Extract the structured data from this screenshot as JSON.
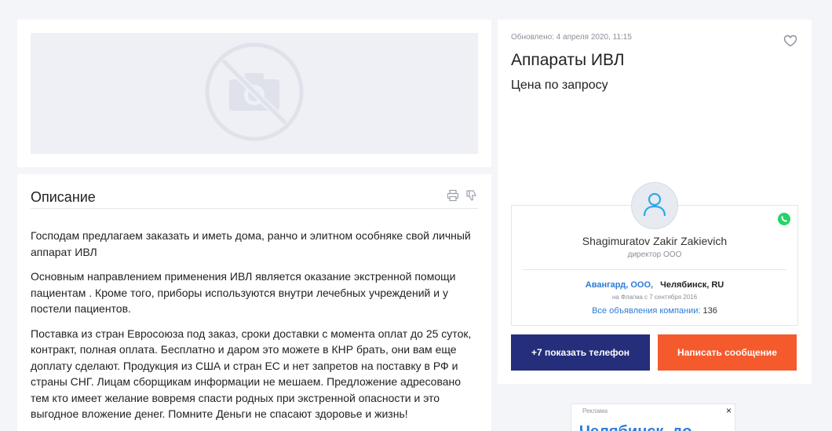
{
  "listing": {
    "updated": "Обновлено: 4 апреля 2020, 11:15",
    "title": "Аппараты ИВЛ",
    "price": "Цена по запросу"
  },
  "description": {
    "heading": "Описание",
    "paragraphs": [
      "Господам предлагаем заказать и иметь дома, ранчо и элитном особняке свой личный аппарат ИВЛ",
      "Основным направлением применения ИВЛ является оказание экстренной помощи пациентам . Кроме того, приборы используются внутри лечебных учреждений и у постели пациентов.",
      "Поставка из стран Евросоюза под заказ, сроки доставки с момента оплат до 25 суток, контракт, полная оплата. Бесплатно и даром это можете в КНР брать, они вам еще доплату сделают. Продукция из США и стран ЕС и нет запретов на поставку в РФ и страны СНГ. Лицам сборщикам информации не мешаем. Предложение адресовано тем кто имеет желание вовремя спасти родных при экстренной опасности и это выгодное вложение денег. Помните Деньги не спасают здоровье и жизнь!"
    ]
  },
  "seller": {
    "name": "Shagimuratov Zakir Zakievich",
    "role": "директор ООО",
    "company": "Авангард, ООО,",
    "city": "Челябинск, RU",
    "since": "на Флагма с 7 сентября 2016",
    "all_ads_label": "Все объявления компании:",
    "all_ads_count": "136"
  },
  "buttons": {
    "phone": "+7 показать телефон",
    "message": "Написать сообщение"
  },
  "ad": {
    "label": "Реклама",
    "close": "×",
    "teaser": "Челябинск, до"
  },
  "icons": {
    "photo": "no-photo-icon",
    "print": "print-icon",
    "complain": "thumb-down-icon",
    "favorite": "heart-icon",
    "user": "user-icon",
    "whatsapp": "whatsapp-icon"
  },
  "colors": {
    "link": "#2d7bd6",
    "phone_button": "#242e7a",
    "message_button": "#f55a2c",
    "whatsapp": "#25d366"
  }
}
